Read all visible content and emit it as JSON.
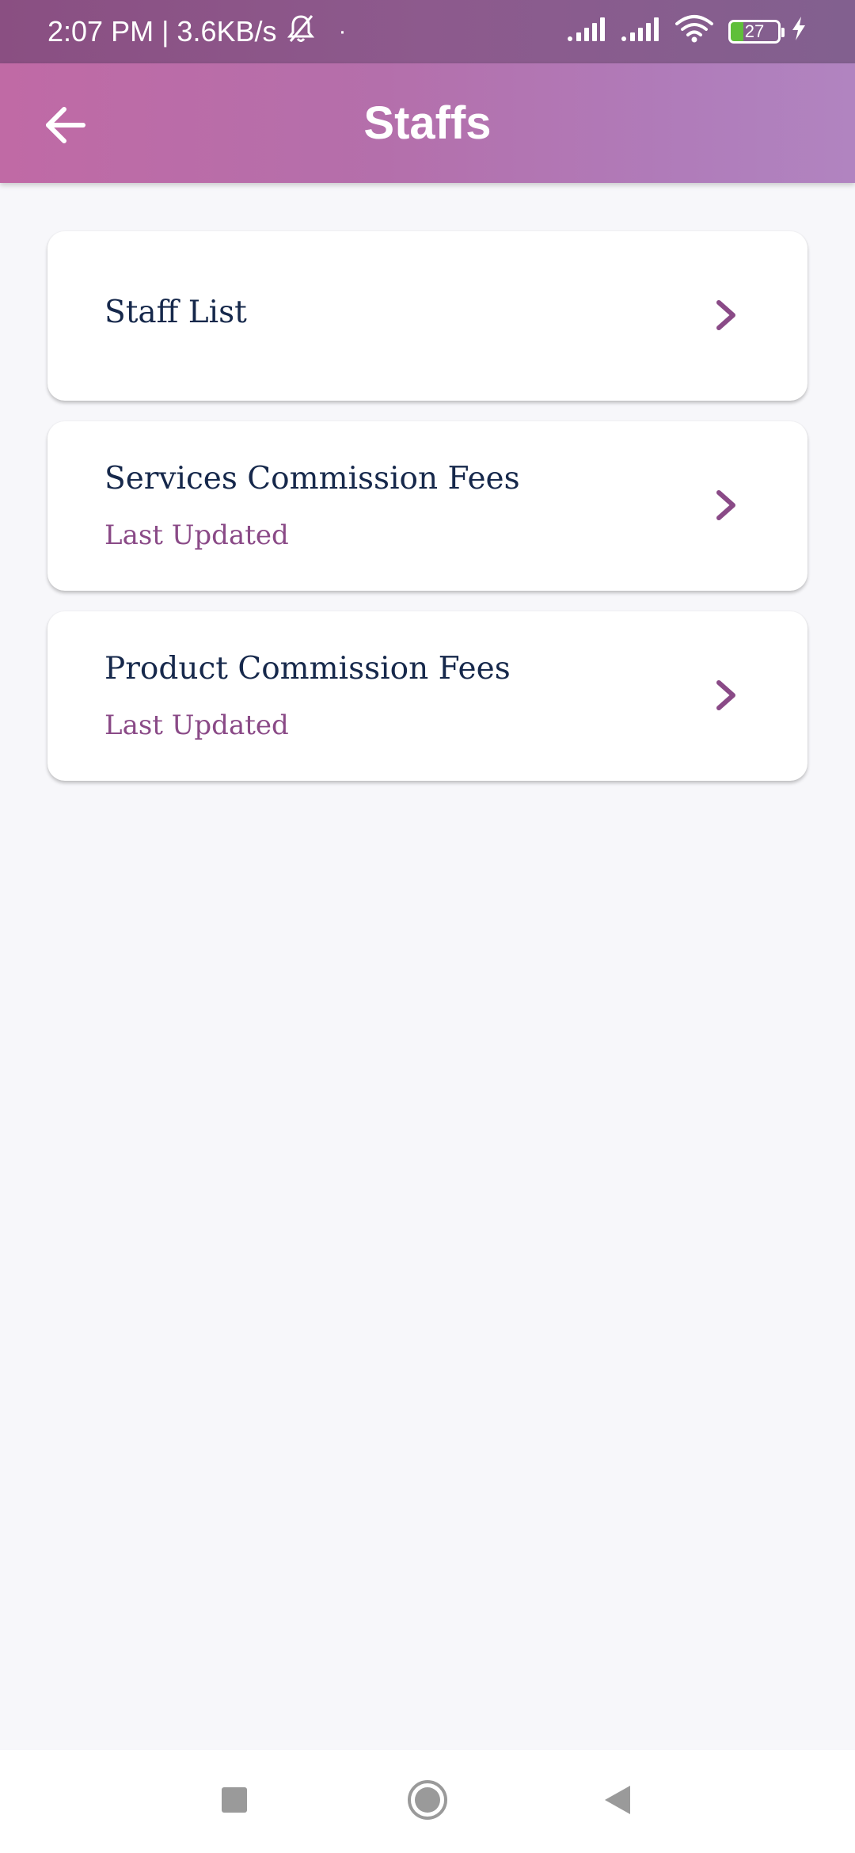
{
  "status_bar": {
    "time_speed": "2:07 PM | 3.6KB/s",
    "dot": "·",
    "battery_level": "27",
    "icons": [
      "bell-off-icon",
      "signal-icon",
      "signal-icon",
      "wifi-icon",
      "battery-icon",
      "charging-icon"
    ]
  },
  "app_bar": {
    "title": "Staffs",
    "back_icon": "arrow-left-icon"
  },
  "menu": {
    "items": [
      {
        "title": "Staff List",
        "subtitle": ""
      },
      {
        "title": "Services Commission Fees",
        "subtitle": "Last Updated"
      },
      {
        "title": "Product Commission Fees",
        "subtitle": "Last Updated"
      }
    ]
  },
  "nav_bar": {
    "icons": [
      "recents-square-icon",
      "home-circle-icon",
      "back-triangle-icon"
    ]
  },
  "colors": {
    "app_bar_start": "#c06aa5",
    "app_bar_end": "#b184c0",
    "title_text": "#16284b",
    "accent": "#8a4a87",
    "background": "#f7f7fa"
  }
}
